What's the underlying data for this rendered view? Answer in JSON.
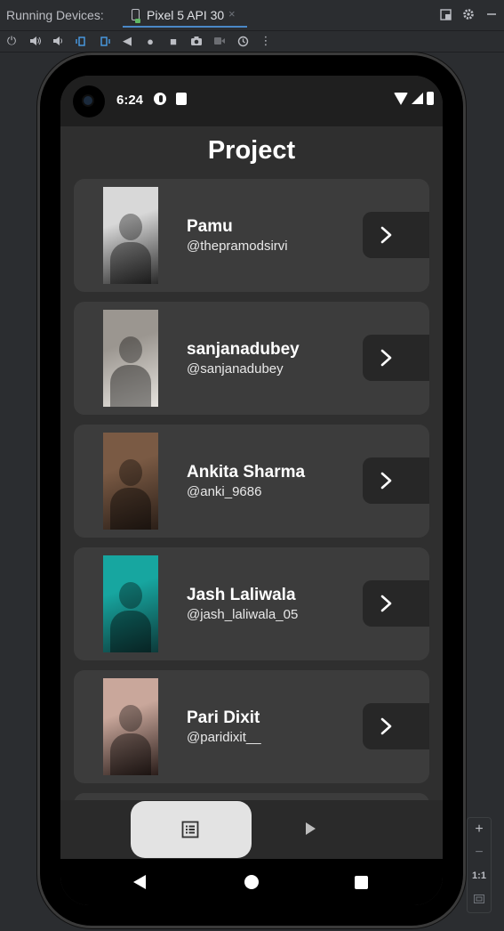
{
  "ide": {
    "panel_title": "Running Devices:",
    "tab_label": "Pixel 5 API 30",
    "tab_close": "×",
    "zoom_in": "+",
    "zoom_out": "−",
    "zoom_actual": "1:1"
  },
  "status_bar": {
    "time": "6:24"
  },
  "app": {
    "title": "Project",
    "items": [
      {
        "name": "Pamu",
        "handle": "@thepramodsirvi",
        "thumb_colors": [
          "#d8d8d8",
          "#2a2a2a"
        ]
      },
      {
        "name": "sanjanadubey",
        "handle": "@sanjanadubey",
        "thumb_colors": [
          "#9b9690",
          "#e6e3de"
        ]
      },
      {
        "name": "Ankita Sharma",
        "handle": "@anki_9686",
        "thumb_colors": [
          "#7a5a44",
          "#2b1f18"
        ]
      },
      {
        "name": "Jash Laliwala",
        "handle": "@jash_laliwala_05",
        "thumb_colors": [
          "#17a6a0",
          "#0d3a3a"
        ]
      },
      {
        "name": "Pari Dixit",
        "handle": "@paridixit__",
        "thumb_colors": [
          "#c9a79b",
          "#2a1d1a"
        ]
      }
    ]
  },
  "bottom_nav": {
    "active": "list",
    "items": [
      "list-icon",
      "play-icon"
    ]
  },
  "colors": {
    "background": "#2f2f2f",
    "card": "#3c3c3c",
    "button": "#272727",
    "nav_active": "#e3e3e3"
  }
}
